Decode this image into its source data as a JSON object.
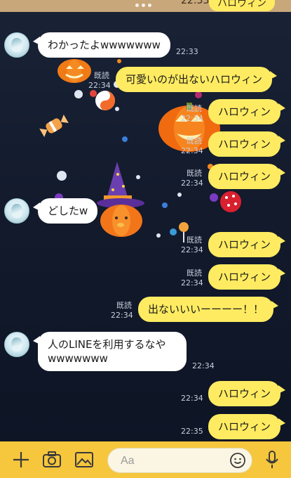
{
  "status": {
    "peek_time": "22:33",
    "peek_text": "ハロウィン"
  },
  "messages": [
    {
      "side": "in",
      "text": "わかったよwwwwwww",
      "time": "22:33"
    },
    {
      "side": "out",
      "text": "可愛いのが出ないハロウィン",
      "read": "既読",
      "time": "22:34"
    },
    {
      "side": "out",
      "text": "ハロウィン",
      "read": "既読",
      "time": "22:34"
    },
    {
      "side": "out",
      "text": "ハロウィン",
      "read": "既読",
      "time": "22:34"
    },
    {
      "side": "out",
      "text": "ハロウィン",
      "read": "既読",
      "time": "22:34"
    },
    {
      "side": "in",
      "text": "どしたw",
      "time": ""
    },
    {
      "side": "out",
      "text": "ハロウィン",
      "read": "既読",
      "time": "22:34"
    },
    {
      "side": "out",
      "text": "ハロウィン",
      "read": "既読",
      "time": "22:34"
    },
    {
      "side": "out",
      "text": "出ないいいーーーー！！",
      "read": "既読",
      "time": "22:34"
    },
    {
      "side": "in",
      "text_lines": [
        "人のLINEを利用するなや",
        "wwwwwww"
      ],
      "time": "22:34"
    },
    {
      "side": "out",
      "text": "ハロウィン",
      "read": "",
      "time": "22:34"
    },
    {
      "side": "out",
      "text": "ハロウィン",
      "read": "",
      "time": "22:35"
    }
  ],
  "composer": {
    "placeholder": "Aa",
    "tools": [
      "plus-icon",
      "camera-icon",
      "image-icon",
      "emoji-icon",
      "microphone-icon"
    ]
  },
  "colors": {
    "background": "#121a2c",
    "incoming_bubble": "#ffffff",
    "outgoing_bubble": "#ffeb61",
    "composer_bar": "#f6c63c"
  }
}
